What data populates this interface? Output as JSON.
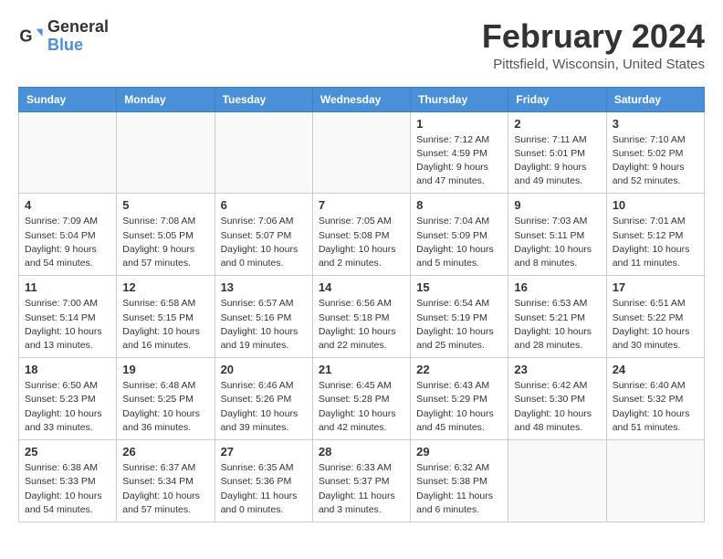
{
  "header": {
    "logo_line1": "General",
    "logo_line2": "Blue",
    "month_year": "February 2024",
    "location": "Pittsfield, Wisconsin, United States"
  },
  "days_of_week": [
    "Sunday",
    "Monday",
    "Tuesday",
    "Wednesday",
    "Thursday",
    "Friday",
    "Saturday"
  ],
  "weeks": [
    [
      {
        "day": "",
        "info": ""
      },
      {
        "day": "",
        "info": ""
      },
      {
        "day": "",
        "info": ""
      },
      {
        "day": "",
        "info": ""
      },
      {
        "day": "1",
        "info": "Sunrise: 7:12 AM\nSunset: 4:59 PM\nDaylight: 9 hours and 47 minutes."
      },
      {
        "day": "2",
        "info": "Sunrise: 7:11 AM\nSunset: 5:01 PM\nDaylight: 9 hours and 49 minutes."
      },
      {
        "day": "3",
        "info": "Sunrise: 7:10 AM\nSunset: 5:02 PM\nDaylight: 9 hours and 52 minutes."
      }
    ],
    [
      {
        "day": "4",
        "info": "Sunrise: 7:09 AM\nSunset: 5:04 PM\nDaylight: 9 hours and 54 minutes."
      },
      {
        "day": "5",
        "info": "Sunrise: 7:08 AM\nSunset: 5:05 PM\nDaylight: 9 hours and 57 minutes."
      },
      {
        "day": "6",
        "info": "Sunrise: 7:06 AM\nSunset: 5:07 PM\nDaylight: 10 hours and 0 minutes."
      },
      {
        "day": "7",
        "info": "Sunrise: 7:05 AM\nSunset: 5:08 PM\nDaylight: 10 hours and 2 minutes."
      },
      {
        "day": "8",
        "info": "Sunrise: 7:04 AM\nSunset: 5:09 PM\nDaylight: 10 hours and 5 minutes."
      },
      {
        "day": "9",
        "info": "Sunrise: 7:03 AM\nSunset: 5:11 PM\nDaylight: 10 hours and 8 minutes."
      },
      {
        "day": "10",
        "info": "Sunrise: 7:01 AM\nSunset: 5:12 PM\nDaylight: 10 hours and 11 minutes."
      }
    ],
    [
      {
        "day": "11",
        "info": "Sunrise: 7:00 AM\nSunset: 5:14 PM\nDaylight: 10 hours and 13 minutes."
      },
      {
        "day": "12",
        "info": "Sunrise: 6:58 AM\nSunset: 5:15 PM\nDaylight: 10 hours and 16 minutes."
      },
      {
        "day": "13",
        "info": "Sunrise: 6:57 AM\nSunset: 5:16 PM\nDaylight: 10 hours and 19 minutes."
      },
      {
        "day": "14",
        "info": "Sunrise: 6:56 AM\nSunset: 5:18 PM\nDaylight: 10 hours and 22 minutes."
      },
      {
        "day": "15",
        "info": "Sunrise: 6:54 AM\nSunset: 5:19 PM\nDaylight: 10 hours and 25 minutes."
      },
      {
        "day": "16",
        "info": "Sunrise: 6:53 AM\nSunset: 5:21 PM\nDaylight: 10 hours and 28 minutes."
      },
      {
        "day": "17",
        "info": "Sunrise: 6:51 AM\nSunset: 5:22 PM\nDaylight: 10 hours and 30 minutes."
      }
    ],
    [
      {
        "day": "18",
        "info": "Sunrise: 6:50 AM\nSunset: 5:23 PM\nDaylight: 10 hours and 33 minutes."
      },
      {
        "day": "19",
        "info": "Sunrise: 6:48 AM\nSunset: 5:25 PM\nDaylight: 10 hours and 36 minutes."
      },
      {
        "day": "20",
        "info": "Sunrise: 6:46 AM\nSunset: 5:26 PM\nDaylight: 10 hours and 39 minutes."
      },
      {
        "day": "21",
        "info": "Sunrise: 6:45 AM\nSunset: 5:28 PM\nDaylight: 10 hours and 42 minutes."
      },
      {
        "day": "22",
        "info": "Sunrise: 6:43 AM\nSunset: 5:29 PM\nDaylight: 10 hours and 45 minutes."
      },
      {
        "day": "23",
        "info": "Sunrise: 6:42 AM\nSunset: 5:30 PM\nDaylight: 10 hours and 48 minutes."
      },
      {
        "day": "24",
        "info": "Sunrise: 6:40 AM\nSunset: 5:32 PM\nDaylight: 10 hours and 51 minutes."
      }
    ],
    [
      {
        "day": "25",
        "info": "Sunrise: 6:38 AM\nSunset: 5:33 PM\nDaylight: 10 hours and 54 minutes."
      },
      {
        "day": "26",
        "info": "Sunrise: 6:37 AM\nSunset: 5:34 PM\nDaylight: 10 hours and 57 minutes."
      },
      {
        "day": "27",
        "info": "Sunrise: 6:35 AM\nSunset: 5:36 PM\nDaylight: 11 hours and 0 minutes."
      },
      {
        "day": "28",
        "info": "Sunrise: 6:33 AM\nSunset: 5:37 PM\nDaylight: 11 hours and 3 minutes."
      },
      {
        "day": "29",
        "info": "Sunrise: 6:32 AM\nSunset: 5:38 PM\nDaylight: 11 hours and 6 minutes."
      },
      {
        "day": "",
        "info": ""
      },
      {
        "day": "",
        "info": ""
      }
    ]
  ]
}
